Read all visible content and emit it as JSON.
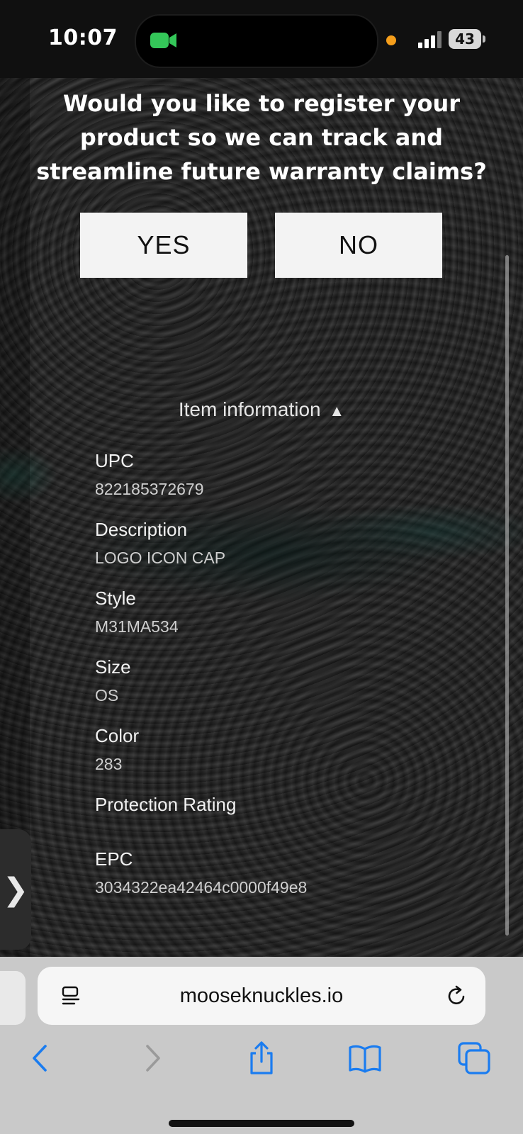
{
  "status_bar": {
    "time": "10:07",
    "battery": "43",
    "facetime_color": "#34c759",
    "indicator_color": "#f59e1b"
  },
  "prompt": {
    "question": "Would you like to register your product so we can track and streamline future warranty claims?",
    "yes_label": "YES",
    "no_label": "NO"
  },
  "item_info": {
    "toggle_label": "Item information",
    "toggle_arrow": "▲",
    "fields": [
      {
        "label": "UPC",
        "value": "822185372679"
      },
      {
        "label": "Description",
        "value": "LOGO ICON CAP"
      },
      {
        "label": "Style",
        "value": "M31MA534"
      },
      {
        "label": "Size",
        "value": "OS"
      },
      {
        "label": "Color",
        "value": "283"
      },
      {
        "label": "Protection Rating",
        "value": ""
      },
      {
        "label": "EPC",
        "value": "3034322ea42464c0000f49e8"
      }
    ]
  },
  "side_tab": {
    "glyph": "❯"
  },
  "browser": {
    "url": "mooseknuckles.io",
    "accent_color": "#1a7cf0",
    "icons": [
      "reader-icon",
      "reload-icon",
      "back-icon",
      "forward-icon",
      "share-icon",
      "bookmarks-icon",
      "tabs-icon"
    ]
  }
}
